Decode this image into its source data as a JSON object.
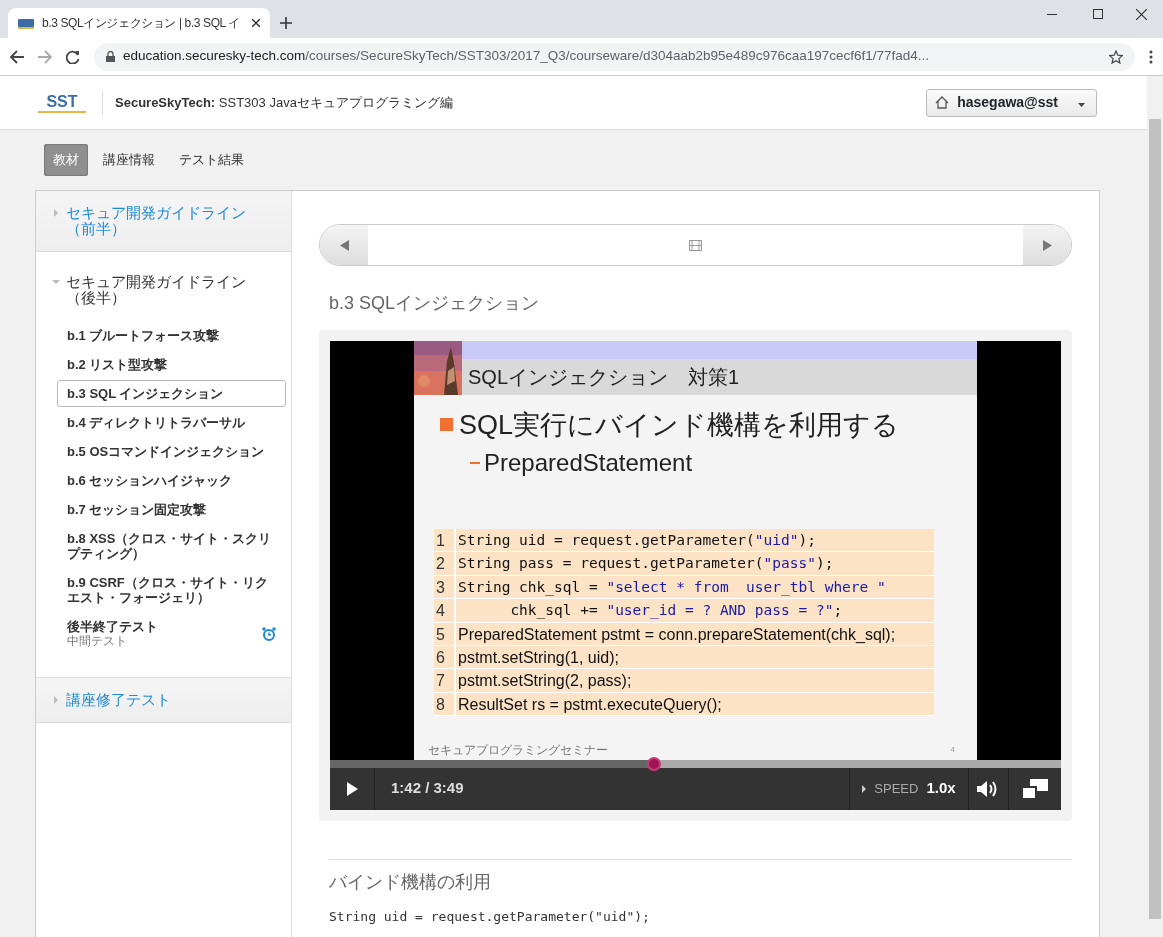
{
  "browser": {
    "tab_title": "b.3 SQLインジェクション | b.3 SQL イ",
    "url_host": "education.securesky-tech.com",
    "url_path": "/courses/SecureSkyTech/SST303/2017_Q3/courseware/d304aab2b95e489c976caa197cecf6f1/77fad4..."
  },
  "header": {
    "logo": "SST",
    "org": "SecureSkyTech:",
    "course": "SST303 Javaセキュアプログラミング編",
    "user": "hasegawa@sst"
  },
  "course_tabs": [
    {
      "label": "教材",
      "selected": true
    },
    {
      "label": "講座情報",
      "selected": false
    },
    {
      "label": "テスト結果",
      "selected": false
    }
  ],
  "sidebar": {
    "sections": [
      {
        "title": "セキュア開発ガイドライン（前半）",
        "expanded": false
      },
      {
        "title": "セキュア開発ガイドライン（後半）",
        "expanded": true,
        "children": [
          {
            "label": "b.1 ブルートフォース攻撃",
            "selected": false
          },
          {
            "label": "b.2 リスト型攻撃",
            "selected": false
          },
          {
            "label": "b.3 SQL インジェクション",
            "selected": true
          },
          {
            "label": "b.4 ディレクトリトラバーサル",
            "selected": false
          },
          {
            "label": "b.5 OSコマンドインジェクション",
            "selected": false
          },
          {
            "label": "b.6 セッションハイジャック",
            "selected": false
          },
          {
            "label": "b.7 セッション固定攻撃",
            "selected": false
          },
          {
            "label": "b.8 XSS（クロス・サイト・スクリプティング）",
            "selected": false
          },
          {
            "label": "b.9 CSRF（クロス・サイト・リクエスト・フォージェリ）",
            "selected": false
          },
          {
            "label": "後半終了テスト",
            "subtitle": "中間テスト",
            "selected": false,
            "timed": true
          }
        ]
      },
      {
        "title": "講座修了テスト",
        "expanded": false
      }
    ]
  },
  "unit": {
    "title": "b.3 SQLインジェクション"
  },
  "video": {
    "slide": {
      "title": "SQLインジェクション　対策1",
      "heading": "SQL実行にバインド機構を利用する",
      "subheading": "PreparedStatement",
      "code": [
        {
          "number": "1",
          "kind": "mono",
          "parts": [
            {
              "text": "String uid = request.getParameter(",
              "kind": "plain"
            },
            {
              "text": "\"uid\"",
              "kind": "string"
            },
            {
              "text": ");",
              "kind": "plain"
            }
          ]
        },
        {
          "number": "2",
          "kind": "mono",
          "parts": [
            {
              "text": "String pass = request.getParameter(",
              "kind": "plain"
            },
            {
              "text": "\"pass\"",
              "kind": "string"
            },
            {
              "text": ");",
              "kind": "plain"
            }
          ]
        },
        {
          "number": "3",
          "kind": "mono",
          "parts": [
            {
              "text": "String chk_sql = ",
              "kind": "plain"
            },
            {
              "text": "\"select * from  user_tbl where \"",
              "kind": "string"
            }
          ]
        },
        {
          "number": "4",
          "kind": "mono",
          "parts": [
            {
              "text": "      chk_sql += ",
              "kind": "plain"
            },
            {
              "text": "\"user_id = ? AND pass = ?\"",
              "kind": "string"
            },
            {
              "text": ";",
              "kind": "plain"
            }
          ]
        },
        {
          "number": "5",
          "kind": "sans",
          "parts": [
            {
              "text": "PreparedStatement pstmt = conn.prepareStatement(chk_sql);",
              "kind": "plain"
            }
          ]
        },
        {
          "number": "6",
          "kind": "sans",
          "parts": [
            {
              "text": "pstmt.setString(1, uid);",
              "kind": "plain"
            }
          ]
        },
        {
          "number": "7",
          "kind": "sans",
          "parts": [
            {
              "text": "pstmt.setString(2, pass);",
              "kind": "plain"
            }
          ]
        },
        {
          "number": "8",
          "kind": "sans",
          "parts": [
            {
              "text": "ResultSet rs = pstmt.executeQuery();",
              "kind": "plain"
            }
          ]
        }
      ],
      "footer": "セキュアプログラミングセミナー",
      "page": "4"
    },
    "level": 0.443,
    "time": "1:42 / 3:49",
    "speed_label": "SPEED",
    "speed": "1.0x"
  },
  "section": {
    "title": "バインド機構の利用",
    "code": "String uid = request.getParameter(\"uid\");"
  }
}
